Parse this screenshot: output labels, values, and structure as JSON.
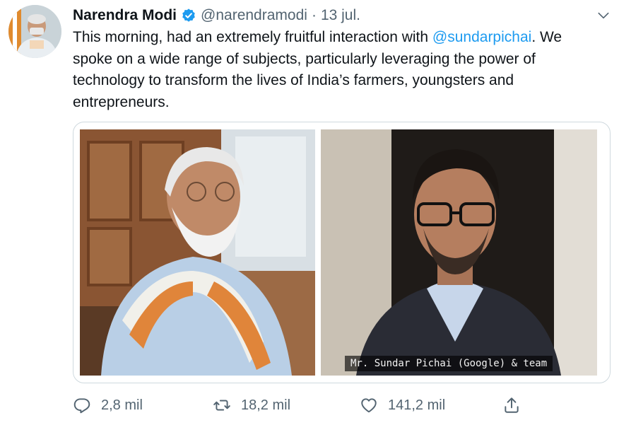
{
  "author": {
    "display_name": "Narendra Modi",
    "handle": "@narendramodi",
    "separator": "·",
    "date": "13 jul.",
    "verified": true,
    "avatar_icon": "avatar-photo"
  },
  "tweet": {
    "text_before": "This morning, had an extremely fruitful interaction with ",
    "mention": "@sundarpichai",
    "text_after": ". We spoke on a wide range of subjects, particularly leveraging the power of technology to transform the lives of India’s farmers, youngsters and entrepreneurs."
  },
  "media": {
    "photos": [
      {
        "icon": "photo-narendra-modi"
      },
      {
        "icon": "photo-sundar-pichai",
        "caption": "Mr. Sundar Pichai (Google) & team"
      }
    ]
  },
  "actions": {
    "reply_count": "2,8 mil",
    "retweet_count": "18,2 mil",
    "like_count": "141,2 mil"
  },
  "colors": {
    "link": "#1d9bf0",
    "verified": "#1d9bf0",
    "secondary_text": "#536471",
    "border": "#cfd9de"
  }
}
